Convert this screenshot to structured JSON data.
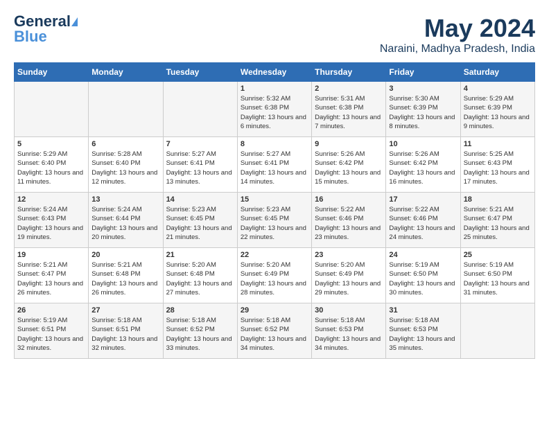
{
  "logo": {
    "line1": "General",
    "line2": "Blue"
  },
  "title": "May 2024",
  "location": "Naraini, Madhya Pradesh, India",
  "weekdays": [
    "Sunday",
    "Monday",
    "Tuesday",
    "Wednesday",
    "Thursday",
    "Friday",
    "Saturday"
  ],
  "weeks": [
    [
      {
        "day": "",
        "info": ""
      },
      {
        "day": "",
        "info": ""
      },
      {
        "day": "",
        "info": ""
      },
      {
        "day": "1",
        "info": "Sunrise: 5:32 AM\nSunset: 6:38 PM\nDaylight: 13 hours\nand 6 minutes."
      },
      {
        "day": "2",
        "info": "Sunrise: 5:31 AM\nSunset: 6:38 PM\nDaylight: 13 hours\nand 7 minutes."
      },
      {
        "day": "3",
        "info": "Sunrise: 5:30 AM\nSunset: 6:39 PM\nDaylight: 13 hours\nand 8 minutes."
      },
      {
        "day": "4",
        "info": "Sunrise: 5:29 AM\nSunset: 6:39 PM\nDaylight: 13 hours\nand 9 minutes."
      }
    ],
    [
      {
        "day": "5",
        "info": "Sunrise: 5:29 AM\nSunset: 6:40 PM\nDaylight: 13 hours\nand 11 minutes."
      },
      {
        "day": "6",
        "info": "Sunrise: 5:28 AM\nSunset: 6:40 PM\nDaylight: 13 hours\nand 12 minutes."
      },
      {
        "day": "7",
        "info": "Sunrise: 5:27 AM\nSunset: 6:41 PM\nDaylight: 13 hours\nand 13 minutes."
      },
      {
        "day": "8",
        "info": "Sunrise: 5:27 AM\nSunset: 6:41 PM\nDaylight: 13 hours\nand 14 minutes."
      },
      {
        "day": "9",
        "info": "Sunrise: 5:26 AM\nSunset: 6:42 PM\nDaylight: 13 hours\nand 15 minutes."
      },
      {
        "day": "10",
        "info": "Sunrise: 5:26 AM\nSunset: 6:42 PM\nDaylight: 13 hours\nand 16 minutes."
      },
      {
        "day": "11",
        "info": "Sunrise: 5:25 AM\nSunset: 6:43 PM\nDaylight: 13 hours\nand 17 minutes."
      }
    ],
    [
      {
        "day": "12",
        "info": "Sunrise: 5:24 AM\nSunset: 6:43 PM\nDaylight: 13 hours\nand 19 minutes."
      },
      {
        "day": "13",
        "info": "Sunrise: 5:24 AM\nSunset: 6:44 PM\nDaylight: 13 hours\nand 20 minutes."
      },
      {
        "day": "14",
        "info": "Sunrise: 5:23 AM\nSunset: 6:45 PM\nDaylight: 13 hours\nand 21 minutes."
      },
      {
        "day": "15",
        "info": "Sunrise: 5:23 AM\nSunset: 6:45 PM\nDaylight: 13 hours\nand 22 minutes."
      },
      {
        "day": "16",
        "info": "Sunrise: 5:22 AM\nSunset: 6:46 PM\nDaylight: 13 hours\nand 23 minutes."
      },
      {
        "day": "17",
        "info": "Sunrise: 5:22 AM\nSunset: 6:46 PM\nDaylight: 13 hours\nand 24 minutes."
      },
      {
        "day": "18",
        "info": "Sunrise: 5:21 AM\nSunset: 6:47 PM\nDaylight: 13 hours\nand 25 minutes."
      }
    ],
    [
      {
        "day": "19",
        "info": "Sunrise: 5:21 AM\nSunset: 6:47 PM\nDaylight: 13 hours\nand 26 minutes."
      },
      {
        "day": "20",
        "info": "Sunrise: 5:21 AM\nSunset: 6:48 PM\nDaylight: 13 hours\nand 26 minutes."
      },
      {
        "day": "21",
        "info": "Sunrise: 5:20 AM\nSunset: 6:48 PM\nDaylight: 13 hours\nand 27 minutes."
      },
      {
        "day": "22",
        "info": "Sunrise: 5:20 AM\nSunset: 6:49 PM\nDaylight: 13 hours\nand 28 minutes."
      },
      {
        "day": "23",
        "info": "Sunrise: 5:20 AM\nSunset: 6:49 PM\nDaylight: 13 hours\nand 29 minutes."
      },
      {
        "day": "24",
        "info": "Sunrise: 5:19 AM\nSunset: 6:50 PM\nDaylight: 13 hours\nand 30 minutes."
      },
      {
        "day": "25",
        "info": "Sunrise: 5:19 AM\nSunset: 6:50 PM\nDaylight: 13 hours\nand 31 minutes."
      }
    ],
    [
      {
        "day": "26",
        "info": "Sunrise: 5:19 AM\nSunset: 6:51 PM\nDaylight: 13 hours\nand 32 minutes."
      },
      {
        "day": "27",
        "info": "Sunrise: 5:18 AM\nSunset: 6:51 PM\nDaylight: 13 hours\nand 32 minutes."
      },
      {
        "day": "28",
        "info": "Sunrise: 5:18 AM\nSunset: 6:52 PM\nDaylight: 13 hours\nand 33 minutes."
      },
      {
        "day": "29",
        "info": "Sunrise: 5:18 AM\nSunset: 6:52 PM\nDaylight: 13 hours\nand 34 minutes."
      },
      {
        "day": "30",
        "info": "Sunrise: 5:18 AM\nSunset: 6:53 PM\nDaylight: 13 hours\nand 34 minutes."
      },
      {
        "day": "31",
        "info": "Sunrise: 5:18 AM\nSunset: 6:53 PM\nDaylight: 13 hours\nand 35 minutes."
      },
      {
        "day": "",
        "info": ""
      }
    ]
  ]
}
